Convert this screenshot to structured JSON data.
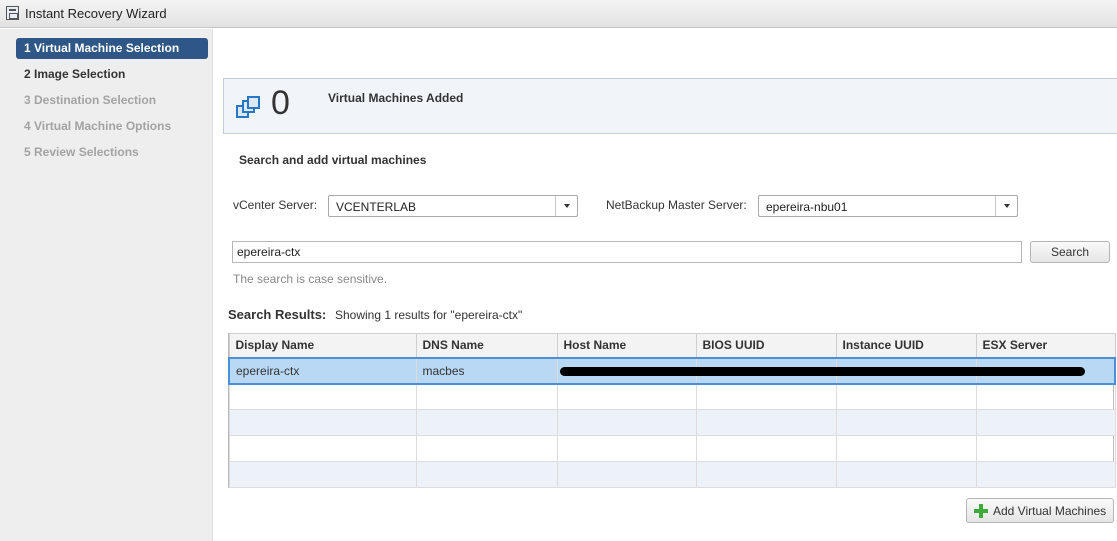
{
  "window": {
    "title": "Instant Recovery Wizard"
  },
  "steps": [
    {
      "label": "1  Virtual Machine Selection",
      "state": "active"
    },
    {
      "label": "2  Image Selection",
      "state": "enabled"
    },
    {
      "label": "3  Destination Selection",
      "state": "disabled"
    },
    {
      "label": "4  Virtual Machine Options",
      "state": "disabled"
    },
    {
      "label": "5  Review Selections",
      "state": "disabled"
    }
  ],
  "summary": {
    "count": "0",
    "label": "Virtual Machines Added",
    "icon": "virtual-machines-icon"
  },
  "search_section": {
    "title": "Search and add virtual machines",
    "vcenter_label": "vCenter Server:",
    "vcenter_value": "VCENTERLAB",
    "master_label": "NetBackup Master Server:",
    "master_value": "epereira-nbu01",
    "query": "epereira-ctx",
    "search_button": "Search",
    "hint": "The search is case sensitive."
  },
  "results": {
    "label": "Search Results:",
    "summary": "Showing 1 results for \"epereira-ctx\"",
    "columns": [
      "Display Name",
      "DNS Name",
      "Host Name",
      "BIOS UUID",
      "Instance UUID",
      "ESX Server"
    ],
    "rows": [
      [
        "epereira-ctx",
        "macbes",
        "",
        "",
        "",
        ""
      ]
    ]
  },
  "add_button": "Add Virtual Machines",
  "colors": {
    "active_step": "#2e5686",
    "selected_row": "#b8d8f4",
    "accent": "#2a76c6"
  }
}
